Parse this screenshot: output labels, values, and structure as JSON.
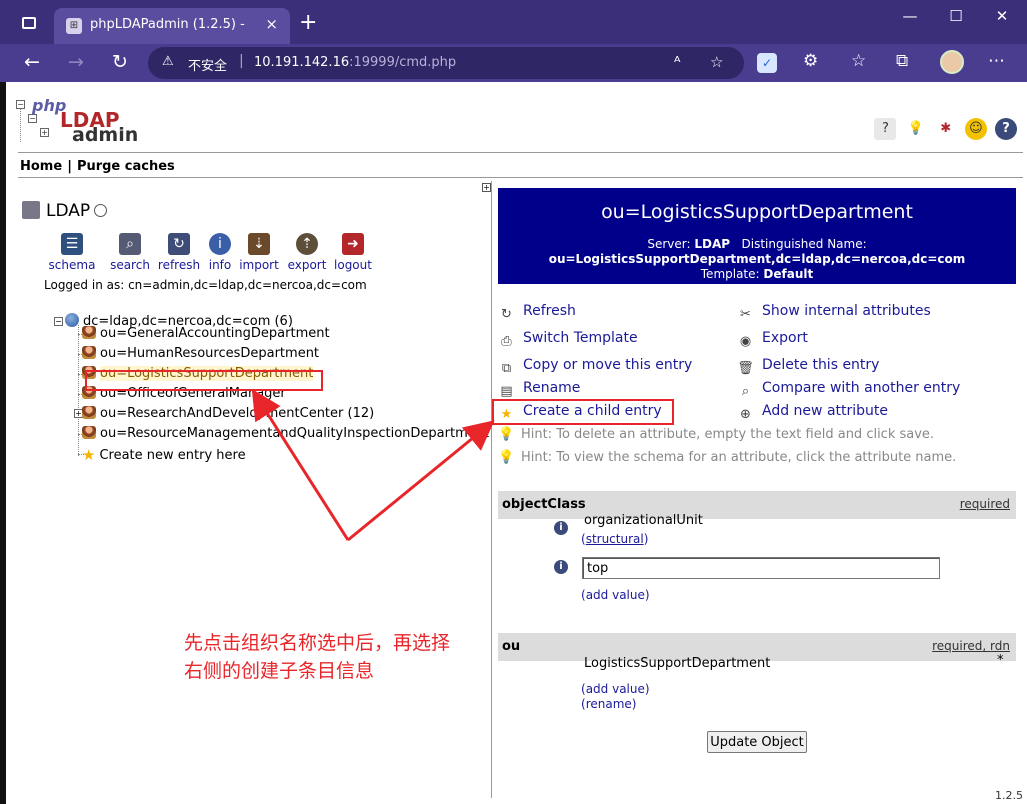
{
  "browser": {
    "tab_title": "phpLDAPadmin (1.2.5) -",
    "tab_close": "×",
    "new_tab": "+",
    "insecure_label": "不安全",
    "address_sep": "|",
    "url_host": "10.191.142.16",
    "url_rest": ":19999/cmd.php",
    "buttons": {
      "back": "←",
      "forward": "→",
      "reload": "↻",
      "minimize": "—",
      "maximize": "☐",
      "close": "✕"
    }
  },
  "header": {
    "logo": {
      "php": "php",
      "ldap": "LDAP",
      "admin": "admin"
    },
    "menu": [
      {
        "label": "Home"
      },
      {
        "label": "Purge caches"
      }
    ],
    "menu_sep": "|"
  },
  "left": {
    "server_name": "LDAP",
    "actions": [
      {
        "label": "schema",
        "icon": "schema-icon",
        "color": "#2f4f7f"
      },
      {
        "label": "search",
        "icon": "search-icon",
        "color": "#555a75"
      },
      {
        "label": "refresh",
        "icon": "refresh-icon",
        "color": "#3d4d78"
      },
      {
        "label": "info",
        "icon": "info-icon",
        "color": "#3b5ea8"
      },
      {
        "label": "import",
        "icon": "import-icon",
        "color": "#6a4a2a"
      },
      {
        "label": "export",
        "icon": "export-icon",
        "color": "#5d4e3a"
      },
      {
        "label": "logout",
        "icon": "logout-icon",
        "color": "#b3262a"
      }
    ],
    "logged_in": "Logged in as: cn=admin,dc=ldap,dc=nercoa,dc=com",
    "tree": {
      "root": "dc=ldap,dc=nercoa,dc=com (6)",
      "children": [
        {
          "label": "ou=GeneralAccountingDepartment"
        },
        {
          "label": "ou=HumanResourcesDepartment"
        },
        {
          "label": "ou=LogisticsSupportDepartment",
          "selected": true
        },
        {
          "label": "ou=OfficeofGeneralManager"
        },
        {
          "label": "ou=ResearchAndDevelopmentCenter (12)",
          "expandable": true
        },
        {
          "label": "ou=ResourceManagementandQualityInspectionDepartment"
        }
      ],
      "create_new": "Create new entry here"
    },
    "annotation_line1": "先点击组织名称选中后，再选择",
    "annotation_line2": "右侧的创建子条目信息"
  },
  "right": {
    "title": "ou=LogisticsSupportDepartment",
    "server_label": "Server:",
    "server_value": "LDAP",
    "dn_label": "Distinguished Name:",
    "dn_value": "ou=LogisticsSupportDepartment,dc=ldap,dc=nercoa,dc=com",
    "template_label": "Template:",
    "template_value": "Default",
    "actions": [
      {
        "label": "Refresh",
        "icon": "refresh-icon"
      },
      {
        "label": "Show internal attributes",
        "icon": "tools-icon"
      },
      {
        "label": "Switch Template",
        "icon": "switch-template-icon"
      },
      {
        "label": "Export",
        "icon": "export-icon"
      },
      {
        "label": "Copy or move this entry",
        "icon": "copy-icon"
      },
      {
        "label": "Delete this entry",
        "icon": "trash-icon"
      },
      {
        "label": "Rename",
        "icon": "rename-icon"
      },
      {
        "label": "Compare with another entry",
        "icon": "compare-icon"
      },
      {
        "label": "Create a child entry",
        "icon": "star-icon"
      },
      {
        "label": "Add new attribute",
        "icon": "add-attribute-icon"
      }
    ],
    "hints": [
      "Hint: To delete an attribute, empty the text field and click save.",
      "Hint: To view the schema for an attribute, click the attribute name."
    ],
    "objectclass": {
      "name": "objectClass",
      "required": "required",
      "value1": "organizationalUnit",
      "structural": "structural",
      "value2": "top",
      "add_value": "add value"
    },
    "ou": {
      "name": "ou",
      "required": "required",
      "rdn": "rdn",
      "value": "LogisticsSupportDepartment",
      "marker": "*",
      "add_value": "add value",
      "rename": "rename"
    },
    "update_button": "Update Object",
    "version": "1.2.5"
  },
  "colors": {
    "accent": "#00008b",
    "annotation": "#e8262a",
    "link": "#1a1a99"
  }
}
